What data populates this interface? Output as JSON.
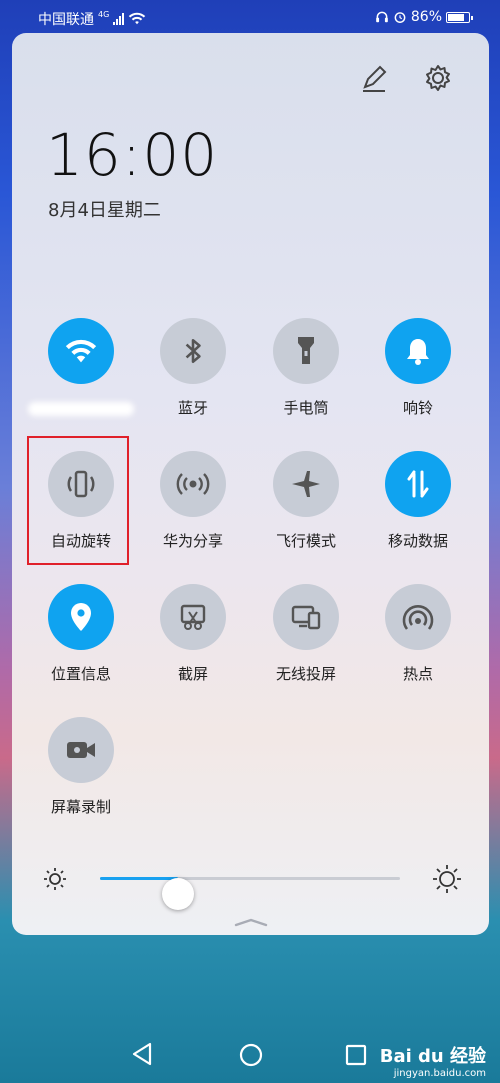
{
  "status_bar": {
    "carrier": "中国联通",
    "network_type": "4G",
    "battery_level": 0.86,
    "battery_percent": "86%"
  },
  "panel": {
    "time": "16:00",
    "date": "8月4日星期二",
    "tiles": [
      {
        "label": "",
        "icon": "wifi-icon",
        "on": true,
        "label_obscured": true
      },
      {
        "label": "蓝牙",
        "icon": "bluetooth-icon",
        "on": false
      },
      {
        "label": "手电筒",
        "icon": "flashlight-icon",
        "on": false
      },
      {
        "label": "响铃",
        "icon": "bell-icon",
        "on": true
      },
      {
        "label": "自动旋转",
        "icon": "auto-rotate-icon",
        "on": false,
        "highlighted": true
      },
      {
        "label": "华为分享",
        "icon": "huawei-share-icon",
        "on": false
      },
      {
        "label": "飞行模式",
        "icon": "airplane-icon",
        "on": false
      },
      {
        "label": "移动数据",
        "icon": "mobile-data-icon",
        "on": true
      },
      {
        "label": "位置信息",
        "icon": "location-icon",
        "on": true
      },
      {
        "label": "截屏",
        "icon": "screenshot-icon",
        "on": false
      },
      {
        "label": "无线投屏",
        "icon": "wireless-projection-icon",
        "on": false
      },
      {
        "label": "热点",
        "icon": "hotspot-icon",
        "on": false
      },
      {
        "label": "屏幕录制",
        "icon": "screen-record-icon",
        "on": false
      }
    ],
    "brightness_level": 0.26
  },
  "watermark": {
    "brand": "Bai du 经验",
    "url": "jingyan.baidu.com"
  },
  "colors": {
    "accent": "#0fa3f0",
    "highlight_box": "#e0202a"
  }
}
